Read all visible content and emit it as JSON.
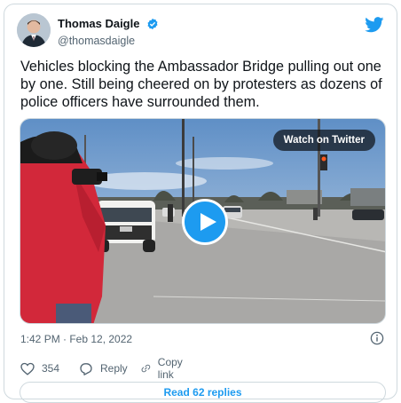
{
  "author": {
    "display_name": "Thomas Daigle",
    "handle": "@thomasdaigle",
    "verified": true
  },
  "tweet": {
    "text": "Vehicles blocking the Ambassador Bridge pulling out one by one. Still being cheered on by protesters as dozens of police officers have surrounded them."
  },
  "media": {
    "watch_label": "Watch on Twitter"
  },
  "meta": {
    "timestamp": "1:42 PM · Feb 12, 2022"
  },
  "actions": {
    "like_count": "354",
    "reply_label": "Reply",
    "copy_label": "Copy link"
  },
  "footer": {
    "read_replies_label": "Read 62 replies"
  },
  "colors": {
    "accent": "#1d9bf0",
    "text": "#0f1419",
    "secondary": "#536471",
    "border": "#cfd9de"
  },
  "icons": [
    "verified-badge-icon",
    "twitter-bird-icon",
    "play-icon",
    "info-icon",
    "heart-icon",
    "reply-icon",
    "link-icon"
  ]
}
